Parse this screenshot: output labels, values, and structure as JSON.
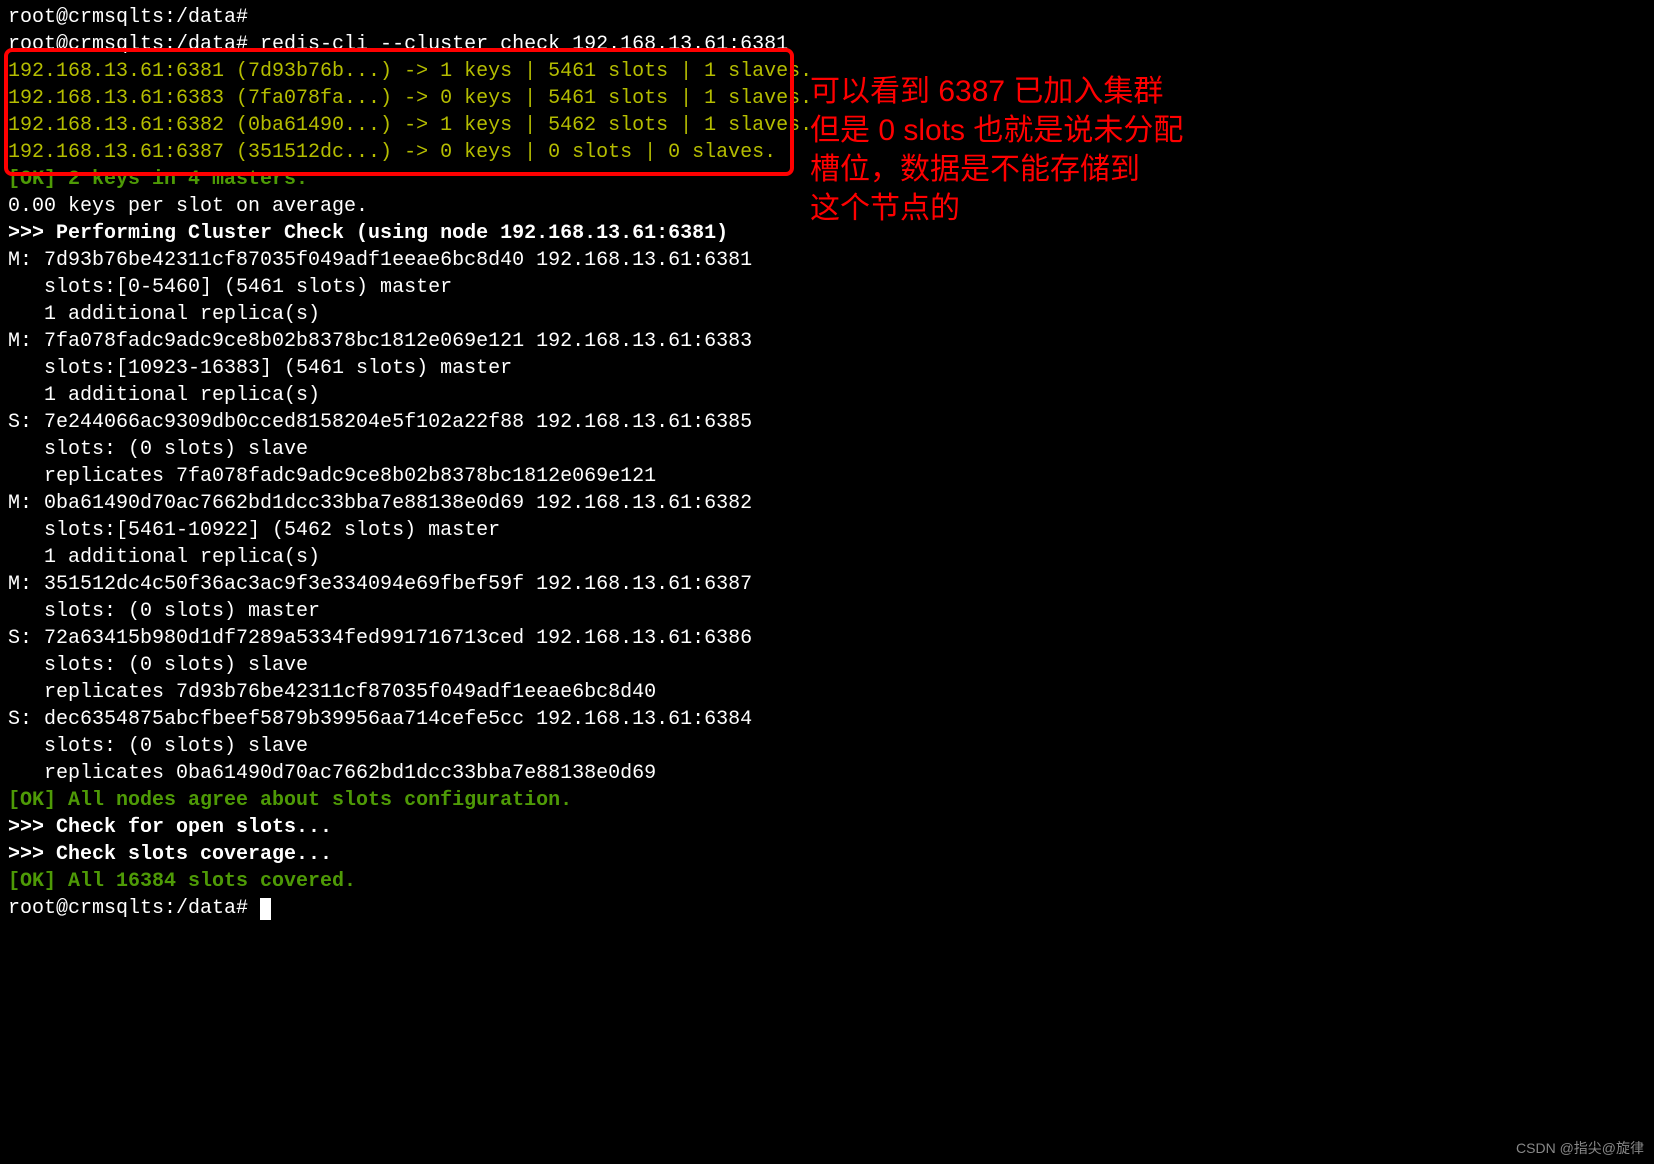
{
  "prompt1": "root@crmsqlts:/data#",
  "prompt2": "root@crmsqlts:/data# redis-cli --cluster check 192.168.13.61:6381",
  "box_line1": "192.168.13.61:6381 (7d93b76b...) -> 1 keys | 5461 slots | 1 slaves.",
  "box_line2": "192.168.13.61:6383 (7fa078fa...) -> 0 keys | 5461 slots | 1 slaves.",
  "box_line3": "192.168.13.61:6382 (0ba61490...) -> 1 keys | 5462 slots | 1 slaves.",
  "box_line4": "192.168.13.61:6387 (351512dc...) -> 0 keys | 0 slots | 0 slaves.",
  "ok1": "[OK] 2 keys in 4 masters.",
  "avg": "0.00 keys per slot on average.",
  "perform": ">>> Performing Cluster Check (using node 192.168.13.61:6381)",
  "m1_l1": "M: 7d93b76be42311cf87035f049adf1eeae6bc8d40 192.168.13.61:6381",
  "m1_l2": "   slots:[0-5460] (5461 slots) master",
  "m1_l3": "   1 additional replica(s)",
  "m2_l1": "M: 7fa078fadc9adc9ce8b02b8378bc1812e069e121 192.168.13.61:6383",
  "m2_l2": "   slots:[10923-16383] (5461 slots) master",
  "m2_l3": "   1 additional replica(s)",
  "s1_l1": "S: 7e244066ac9309db0cced8158204e5f102a22f88 192.168.13.61:6385",
  "s1_l2": "   slots: (0 slots) slave",
  "s1_l3": "   replicates 7fa078fadc9adc9ce8b02b8378bc1812e069e121",
  "m3_l1": "M: 0ba61490d70ac7662bd1dcc33bba7e88138e0d69 192.168.13.61:6382",
  "m3_l2": "   slots:[5461-10922] (5462 slots) master",
  "m3_l3": "   1 additional replica(s)",
  "m4_l1": "M: 351512dc4c50f36ac3ac9f3e334094e69fbef59f 192.168.13.61:6387",
  "m4_l2": "   slots: (0 slots) master",
  "s2_l1": "S: 72a63415b980d1df7289a5334fed991716713ced 192.168.13.61:6386",
  "s2_l2": "   slots: (0 slots) slave",
  "s2_l3": "   replicates 7d93b76be42311cf87035f049adf1eeae6bc8d40",
  "s3_l1": "S: dec6354875abcfbeef5879b39956aa714cefe5cc 192.168.13.61:6384",
  "s3_l2": "   slots: (0 slots) slave",
  "s3_l3": "   replicates 0ba61490d70ac7662bd1dcc33bba7e88138e0d69",
  "ok2": "[OK] All nodes agree about slots configuration.",
  "check_open": ">>> Check for open slots...",
  "check_cov": ">>> Check slots coverage...",
  "ok3": "[OK] All 16384 slots covered.",
  "prompt_last": "root@crmsqlts:/data# ",
  "annotation_l1": "可以看到 6387 已加入集群",
  "annotation_l2": "但是 0 slots 也就是说未分配",
  "annotation_l3": "槽位，数据是不能存储到",
  "annotation_l4": "这个节点的",
  "watermark": "CSDN @指尖@旋律"
}
